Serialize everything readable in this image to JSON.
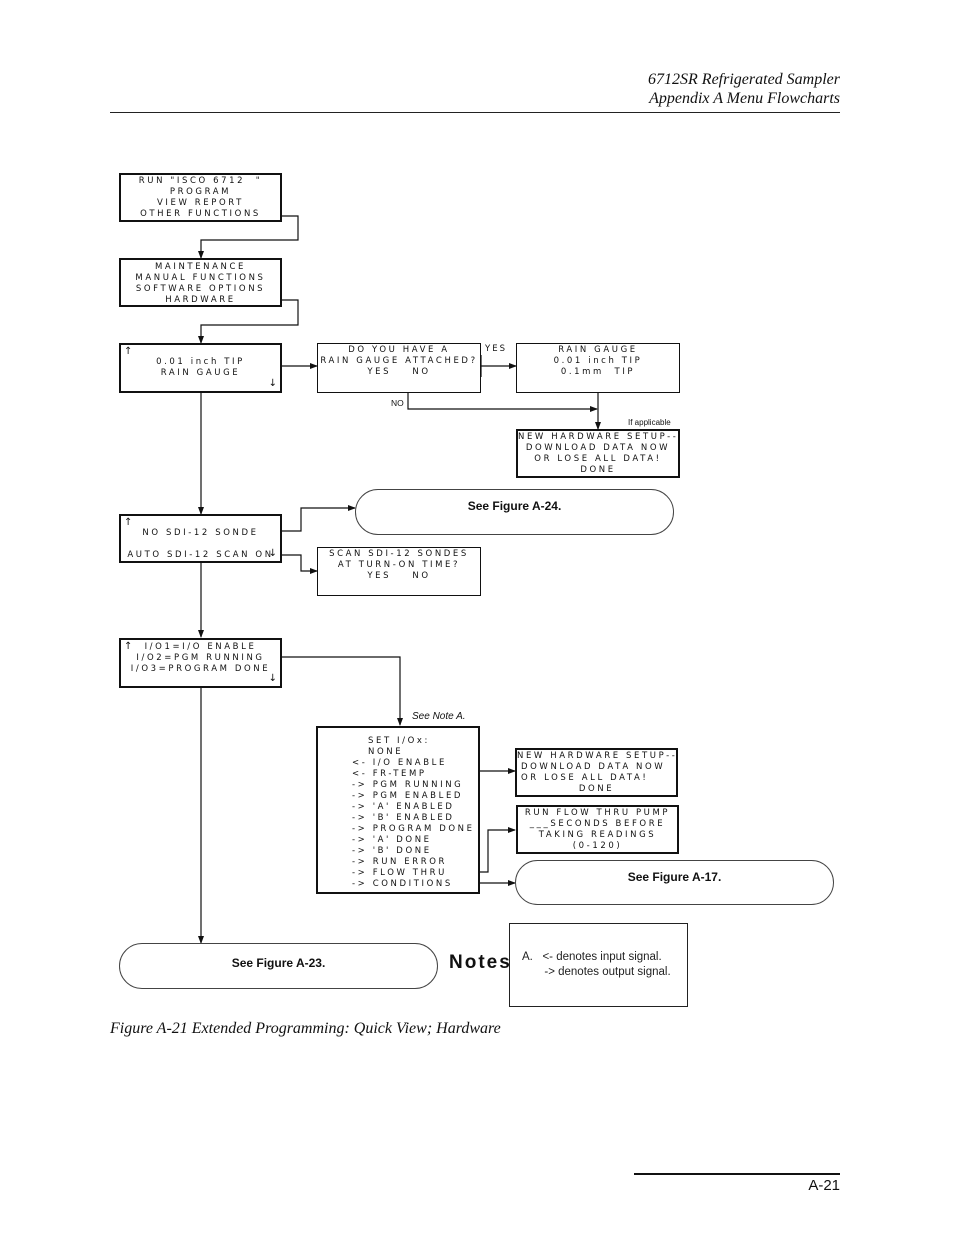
{
  "header": {
    "line1": "6712SR Refrigerated Sampler",
    "line2": "Appendix A  Menu Flowcharts"
  },
  "boxes": {
    "main_menu": [
      "RUN \"ISCO 6712  \"",
      "PROGRAM",
      "VIEW REPORT",
      "OTHER FUNCTIONS"
    ],
    "other_functions": [
      "MAINTENANCE",
      "MANUAL FUNCTIONS",
      "SOFTWARE OPTIONS",
      "HARDWARE"
    ],
    "rain_gauge_screen": [
      "0.01 inch TIP",
      "RAIN GAUGE"
    ],
    "rain_gauge_question": [
      "DO YOU HAVE A",
      "RAIN GAUGE ATTACHED?",
      "YES    NO"
    ],
    "rain_gauge_type": [
      "RAIN GAUGE",
      "0.01 inch TIP",
      "0.1mm  TIP"
    ],
    "new_hw_setup_1": [
      "NEW HARDWARE SETUP--",
      "DOWNLOAD DATA NOW",
      "OR LOSE ALL DATA!",
      "DONE"
    ],
    "sdi_screen": [
      "NO SDI-12 SONDE",
      "AUTO SDI-12 SCAN ON"
    ],
    "sdi_scan_question": [
      "SCAN SDI-12 SONDES",
      "AT TURN-ON TIME?",
      "YES    NO"
    ],
    "io_screen": [
      "I/O1=I/O ENABLE",
      "I/O2=PGM RUNNING",
      "I/O3=PROGRAM DONE"
    ],
    "set_io": [
      "SET I/Ox:",
      "NONE",
      "<- I/O ENABLE",
      "<- FR-TEMP",
      "-> PGM RUNNING",
      "-> PGM ENABLED",
      "-> 'A' ENABLED",
      "-> 'B' ENABLED",
      "-> PROGRAM DONE",
      "-> 'A' DONE",
      "-> 'B' DONE",
      "-> RUN ERROR",
      "-> FLOW THRU",
      "-> CONDITIONS"
    ],
    "new_hw_setup_2": [
      "NEW HARDWARE SETUP--",
      "DOWNLOAD DATA NOW",
      "OR LOSE ALL DATA!",
      "DONE"
    ],
    "flow_thru_pump": [
      "RUN FLOW THRU PUMP",
      "___SECONDS BEFORE",
      "TAKING READINGS",
      "(0-120)"
    ]
  },
  "terminators": {
    "fig_a24": "See Figure A-24.",
    "fig_a17": "See Figure A-17.",
    "fig_a23": "See Figure A-23."
  },
  "labels": {
    "yes": "YES",
    "no": "NO",
    "if_applicable": "If applicable",
    "see_note_a": "See Note A.",
    "up_arrow": "↑",
    "down_arrow": "↓"
  },
  "notes": {
    "title": "Notes",
    "line1": "A.   <- denotes input signal.",
    "line2": "       -> denotes output signal."
  },
  "caption": "Figure A-21 Extended Programming: Quick View; Hardware",
  "page_number": "A-21"
}
